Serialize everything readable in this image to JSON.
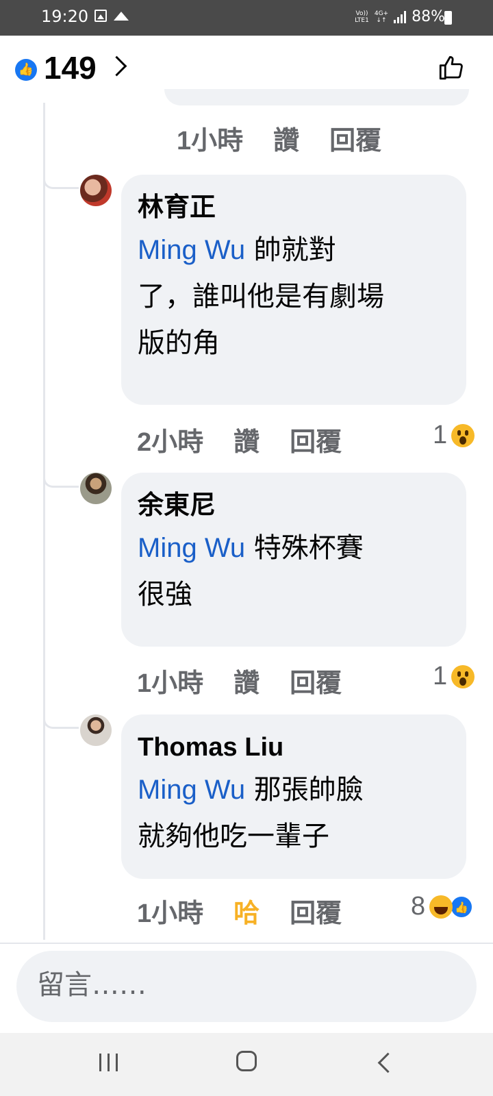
{
  "status_bar": {
    "time": "19:20",
    "network_top": "Vo))",
    "network_bottom": "LTE1",
    "network_type": "4G+",
    "battery": "88%"
  },
  "header": {
    "like_count": "149",
    "like_badge_icon": "like-badge-icon",
    "chevron_icon": "chevron-right-icon",
    "thumb_icon": "thumbs-up-icon"
  },
  "previous_comment_meta": {
    "time": "1小時",
    "like": "讚",
    "reply": "回覆"
  },
  "comments": [
    {
      "author": "林育正",
      "mention": "Ming Wu",
      "text_line1": " 帥就對",
      "text_line2": "了，誰叫他是有劇場",
      "text_line3": "版的角",
      "time": "2小時",
      "like": "讚",
      "reply": "回覆",
      "reaction_count": "1",
      "reaction_icon": "wow-icon"
    },
    {
      "author": "余東尼",
      "mention": "Ming Wu",
      "text_line1": " 特殊杯賽",
      "text_line2": "很強",
      "time": "1小時",
      "like": "讚",
      "reply": "回覆",
      "reaction_count": "1",
      "reaction_icon": "wow-icon"
    },
    {
      "author": "Thomas Liu",
      "mention": "Ming Wu",
      "text_line1": " 那張帥臉",
      "text_line2": "就夠他吃一輩子",
      "time": "1小時",
      "like": "哈",
      "reply": "回覆",
      "reaction_count": "8",
      "reaction_icons": [
        "haha-icon",
        "like-icon"
      ]
    }
  ],
  "composer": {
    "placeholder": "留言……"
  },
  "colors": {
    "mention": "#1a5fc8",
    "bubble": "#f0f2f5",
    "meta": "#65676b",
    "haha": "#f7b125",
    "like_blue": "#1877f2"
  }
}
